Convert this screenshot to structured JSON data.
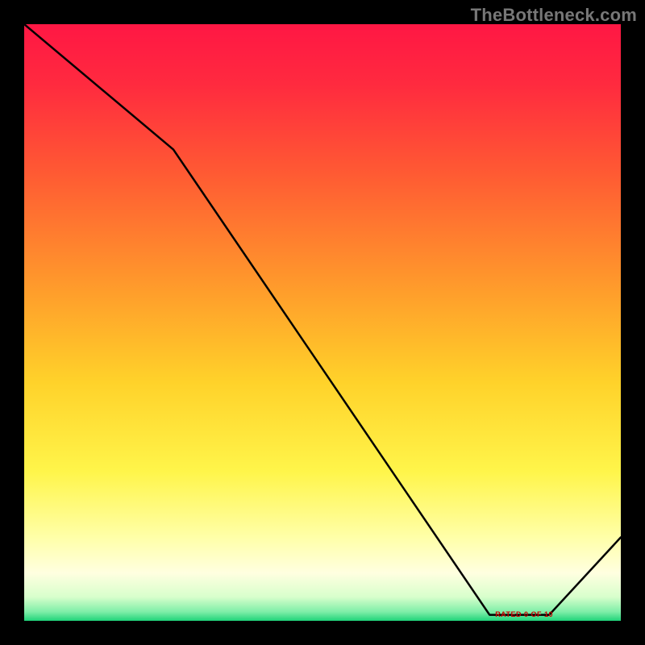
{
  "watermark": "TheBottleneck.com",
  "overlay_label": "RATED 0 OF 10",
  "chart_data": {
    "type": "line",
    "title": "",
    "xlabel": "",
    "ylabel": "",
    "xlim": [
      0,
      100
    ],
    "ylim": [
      0,
      100
    ],
    "grid": false,
    "legend": false,
    "x": [
      0,
      25,
      78,
      88,
      100
    ],
    "values": [
      100,
      79,
      1,
      1,
      14
    ],
    "line_color": "#000000",
    "background_gradient": {
      "stops": [
        {
          "pos": 0.0,
          "color": "#ff1744"
        },
        {
          "pos": 0.1,
          "color": "#ff2a3f"
        },
        {
          "pos": 0.25,
          "color": "#ff5a33"
        },
        {
          "pos": 0.45,
          "color": "#ff9e2b"
        },
        {
          "pos": 0.6,
          "color": "#ffd22a"
        },
        {
          "pos": 0.75,
          "color": "#fff54a"
        },
        {
          "pos": 0.86,
          "color": "#ffffa8"
        },
        {
          "pos": 0.92,
          "color": "#ffffe0"
        },
        {
          "pos": 0.96,
          "color": "#d8ffcc"
        },
        {
          "pos": 0.985,
          "color": "#7eeea8"
        },
        {
          "pos": 1.0,
          "color": "#1fd37a"
        }
      ]
    }
  }
}
